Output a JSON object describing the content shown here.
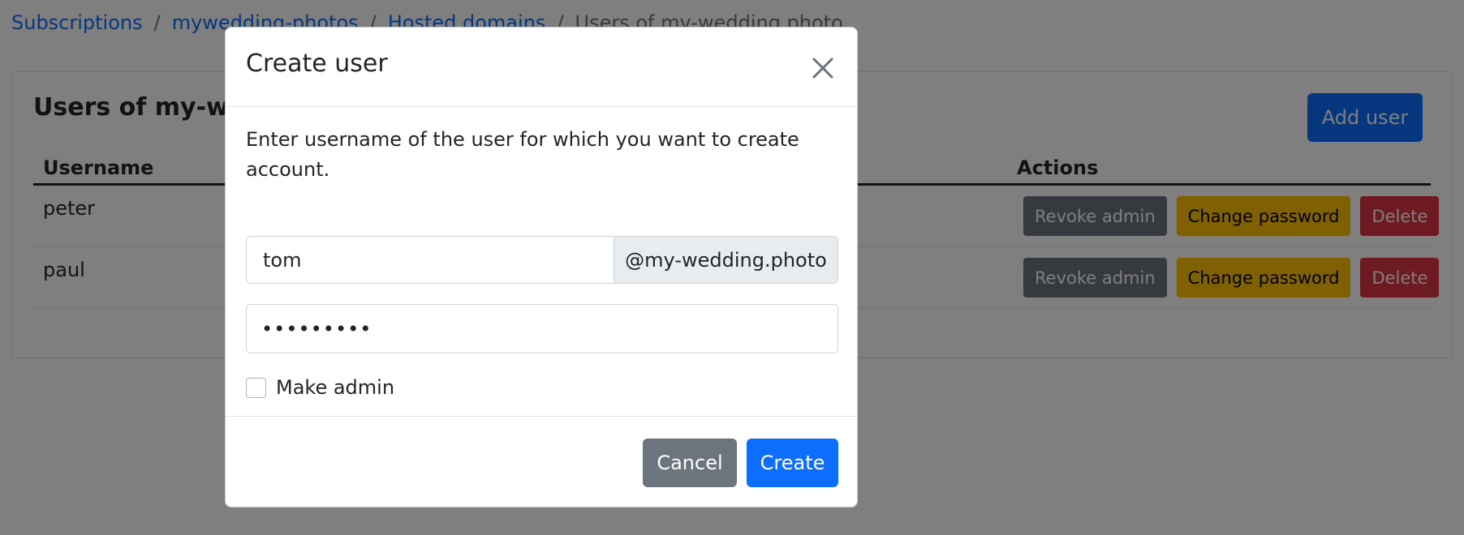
{
  "breadcrumb": {
    "items": [
      "Subscriptions",
      "mywedding-photos",
      "Hosted domains"
    ],
    "separator": "/",
    "current": "Users of my-wedding.photo"
  },
  "card": {
    "title": "Users of my-wedding.photo",
    "add_user_label": "Add user",
    "columns": {
      "username": "Username",
      "actions": "Actions"
    },
    "rows": [
      {
        "username": "peter",
        "revoke": "Revoke admin",
        "change_password": "Change password",
        "delete": "Delete"
      },
      {
        "username": "paul",
        "revoke": "Revoke admin",
        "change_password": "Change password",
        "delete": "Delete"
      }
    ]
  },
  "modal": {
    "title": "Create user",
    "intro": "Enter username of the user for which you want to create account.",
    "username_value": "tom",
    "domain_suffix": "@my-wedding.photo",
    "password_value": "•••••••••",
    "make_admin_label": "Make admin",
    "make_admin_checked": false,
    "cancel_label": "Cancel",
    "create_label": "Create"
  },
  "colors": {
    "primary": "#0d6efd",
    "secondary": "#6c757d",
    "warning": "#ffc107",
    "danger": "#dc3545"
  },
  "icons": {
    "close": "close-icon"
  }
}
